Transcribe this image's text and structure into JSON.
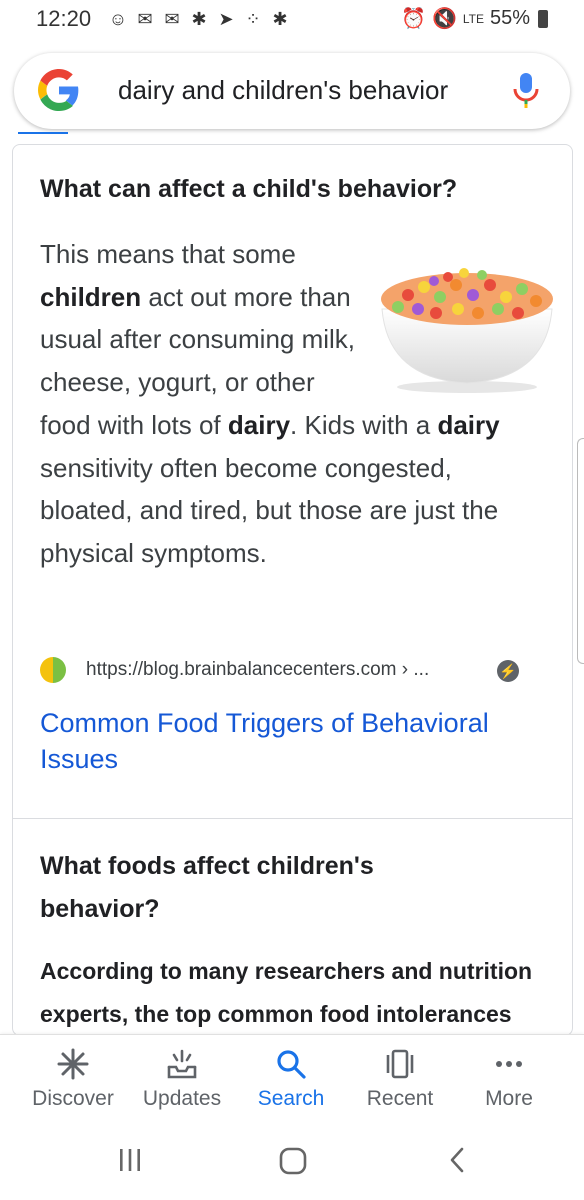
{
  "status_bar": {
    "time": "12:20",
    "battery": "55%",
    "network": "LTE"
  },
  "search": {
    "query": "dairy and children's behavior",
    "logo_icon": "google-g-icon",
    "mic_icon": "mic-icon"
  },
  "card1": {
    "question": "What can affect a child's behavior?",
    "snippet_parts": [
      "This means that some ",
      "children",
      " act out more than usual after consuming milk, cheese, yogurt, or other food with lots of ",
      "dairy",
      ". Kids with a ",
      "dairy",
      " sensitivity often become congested, bloated, and tired, but those are just the physical symptoms."
    ],
    "source_url": "https://blog.brainbalancecenters.com › ...",
    "result_title": "Common Food Triggers of Behavioral Issues"
  },
  "card2": {
    "question": "What foods affect children's behavior?",
    "body": "According to many researchers and nutrition experts, the top common food intolerances"
  },
  "bottom_nav": {
    "items": [
      {
        "label": "Discover",
        "icon": "asterisk-icon"
      },
      {
        "label": "Updates",
        "icon": "inbox-icon"
      },
      {
        "label": "Search",
        "icon": "search-icon",
        "active": true
      },
      {
        "label": "Recent",
        "icon": "recent-icon"
      },
      {
        "label": "More",
        "icon": "more-dots-icon"
      }
    ]
  },
  "colors": {
    "accent": "#1a73e8",
    "link": "#1558d6",
    "text": "#202124"
  }
}
